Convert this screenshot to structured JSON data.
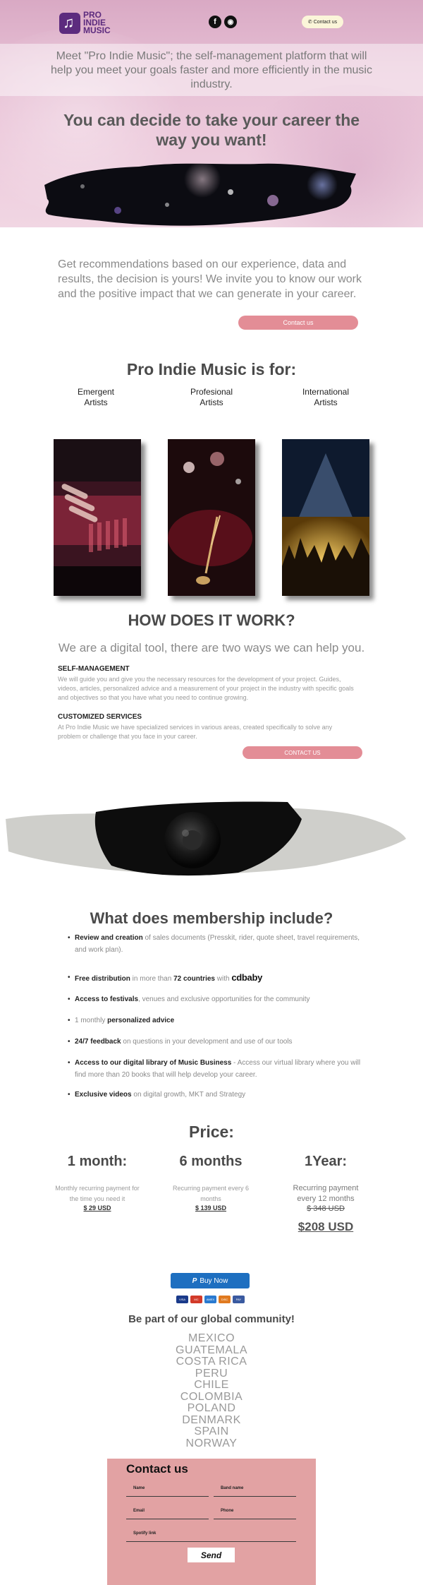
{
  "header": {
    "logo_lines": [
      "PRO",
      "INDIE",
      "MUSIC"
    ],
    "social_icons": [
      "facebook-icon",
      "instagram-icon"
    ],
    "contact_label": "Contact us"
  },
  "hero": {
    "intro": "Meet \"Pro Indie Music\"; the self-management platform that will help you meet your goals faster and more efficiently in the music industry.",
    "title": "You can decide to take your career the way you want!"
  },
  "recommendations": {
    "text": "Get recommendations based on our experience, data and results, the decision is yours! We invite you to know our work and the positive impact that we can generate in your career.",
    "button": "Contact us"
  },
  "for_section": {
    "title": "Pro Indie Music is for:",
    "types": [
      "Emergent\nArtists",
      "Profesional\nArtists",
      "International\nArtists"
    ]
  },
  "how": {
    "title": "HOW DOES IT WORK?",
    "subtitle": "We are a digital tool, there are two ways we can help you.",
    "self_title": "SELF-MANAGEMENT",
    "self_text": "We will guide you and give you the necessary resources for the development of your project. Guides, videos, articles, personalized advice and a measurement of your project in the industry with specific goals and objectives so that you have what you need to continue growing.",
    "custom_title": "CUSTOMIZED SERVICES",
    "custom_text": "At Pro Indie Music we have specialized services in various areas, created specifically to solve any problem or challenge that you face in your career.",
    "button": "CONTACT US"
  },
  "membership": {
    "title": "What does membership include?",
    "items": [
      {
        "bold": "Review and creation",
        "light": " of sales documents (Presskit, rider, quote sheet, travel requirements, and work plan)."
      },
      {
        "bold": "Free distribution",
        "light": " in more than ",
        "bold2": "72 countries",
        "light2": " with ",
        "brand": "cdbaby"
      },
      {
        "bold": "Access to festivals",
        "light": ", venues and exclusive opportunities for the community"
      },
      {
        "light_first": "1 monthly ",
        "bold": "personalized advice"
      },
      {
        "bold": "24/7 feedback",
        "light": " on questions in your development and use of our tools"
      },
      {
        "bold": "Access to our digital library of Music Business",
        "light": " - Access our virtual library where you will find more than 20 books that will help develop your career."
      },
      {
        "bold": "Exclusive videos",
        "light": " on digital growth, MKT and Strategy"
      }
    ]
  },
  "pricing": {
    "title": "Price:",
    "plans": [
      {
        "name": "1 month:",
        "desc": "Monthly recurring payment for the time you need it",
        "price": "$ 29 USD"
      },
      {
        "name": "6 months",
        "desc": "Recurring payment every 6 months",
        "price": "$ 139 USD"
      },
      {
        "name": "1Year:",
        "desc": "Recurring payment every 12 months",
        "old_price": "$ 348 USD",
        "price": "$208 USD"
      }
    ]
  },
  "payment": {
    "button": "Buy Now",
    "cards": [
      "VISA",
      "MC",
      "AMEX",
      "DISC",
      "PAY"
    ],
    "card_colors": [
      "#1a3a8a",
      "#d23a2a",
      "#2a7ad0",
      "#e07a20",
      "#3a5aa0"
    ]
  },
  "community": {
    "title": "Be part of our global community!",
    "countries": [
      "MEXICO",
      "GUATEMALA",
      "COSTA RICA",
      "PERU",
      "CHILE",
      "COLOMBIA",
      "POLAND",
      "DENMARK",
      "SPAIN",
      "NORWAY"
    ]
  },
  "contact_form": {
    "title": "Contact us",
    "fields": {
      "name": "Name",
      "band": "Band name",
      "email": "Email",
      "phone": "Phone",
      "spotify": "Spotify link"
    },
    "send": "Send"
  },
  "colors": {
    "accent_pink": "#e38d96",
    "brand_purple": "#5c2b7e",
    "form_bg": "#e2a2a3",
    "paypal_blue": "#1e6fc0"
  }
}
